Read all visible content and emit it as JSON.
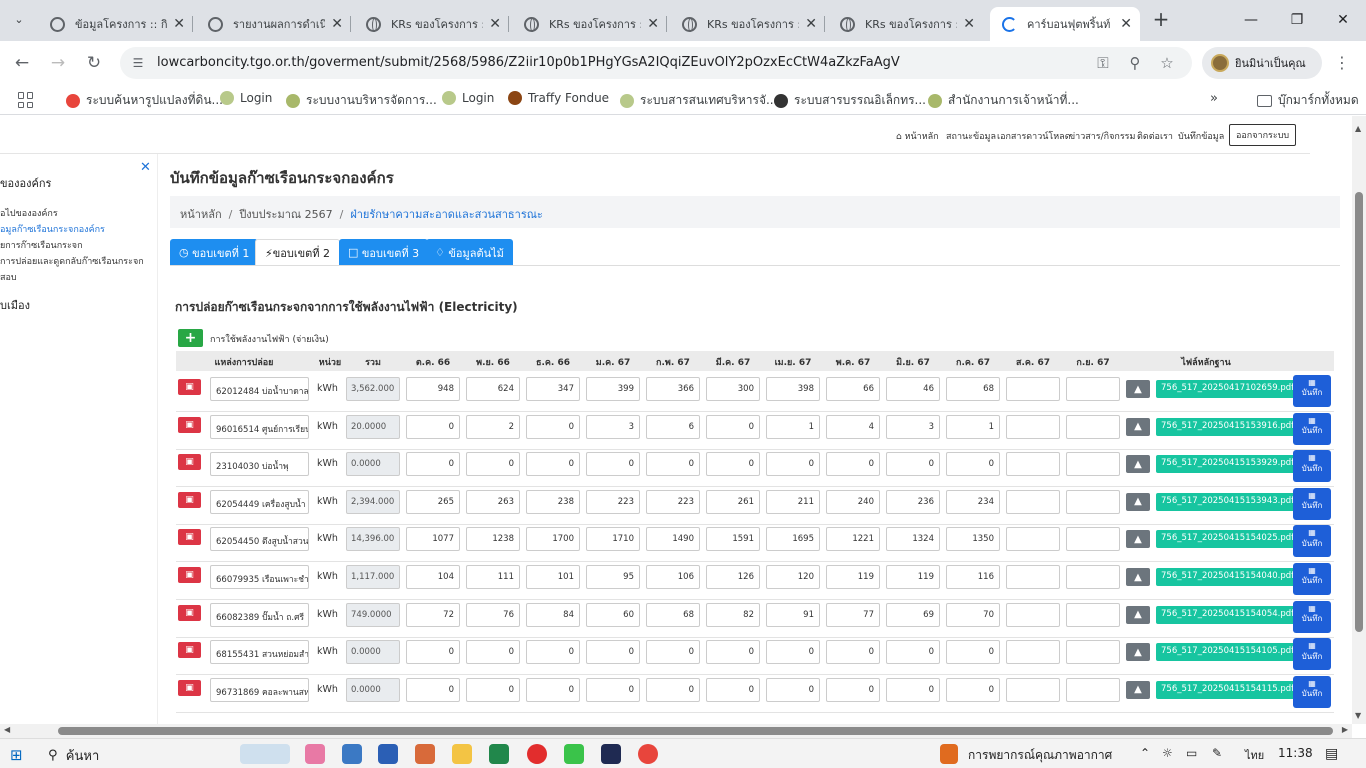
{
  "browser": {
    "tabs": [
      {
        "title": "ข้อมูลโครงการ :: กิจ",
        "active": false
      },
      {
        "title": "รายงานผลการดำเนิ",
        "active": false
      },
      {
        "title": "KRs ของโครงการ ::",
        "active": false
      },
      {
        "title": "KRs ของโครงการ ::",
        "active": false
      },
      {
        "title": "KRs ของโครงการ ::",
        "active": false
      },
      {
        "title": "KRs ของโครงการ ::",
        "active": false
      },
      {
        "title": "คาร์บอนฟุตพริ้นท์",
        "active": true
      }
    ],
    "url": "lowcarboncity.tgo.or.th/goverment/submit/2568/5986/Z2iir10p0b1PHgYGsA2IQqiZEuvOlY2pOzxEcCtW4aZkzFaAgV",
    "profile_label": "ยินมิน่าเป็นคุณ",
    "bookmarks": [
      "ระบบค้นหารูปแปลงที่ดิน...",
      "Login",
      "ระบบงานบริหารจัดการ...",
      "Login",
      "Traffy Fondue",
      "ระบบสารสนเทศบริหารจั...",
      "ระบบสารบรรณอิเล็กทร...",
      "สำนักงานการเจ้าหน้าที่..."
    ],
    "bookmarks_all": "บุ๊กมาร์กทั้งหมด"
  },
  "topnav": {
    "items": [
      "หน้าหลัก",
      "สถานะข้อมูล",
      "เอกสารดาวน์โหลด",
      "ข่าวสาร/กิจกรรม",
      "ติดต่อเรา",
      "บันทึกข้อมูล"
    ],
    "logout": "ออกจากระบบ"
  },
  "sidebar": {
    "heading": "ขององค์กร",
    "items": [
      "อไปขององค์กร",
      "อมูลก๊าซเรือนกระจกองค์กร",
      "ยการก๊าซเรือนกระจก",
      "การปล่อยและดูดกลับก๊าซเรือนกระจก",
      "สอบ"
    ],
    "heading2": "บเมือง"
  },
  "main": {
    "title": "บันทึกข้อมูลก๊าซเรือนกระจกองค์กร",
    "breadcrumb": [
      "หน้าหลัก",
      "ปีงบประมาณ 2567",
      "ฝ่ายรักษาความสะอาดและสวนสาธารณะ"
    ],
    "tabs": [
      "ขอบเขตที่ 1",
      "ขอบเขตที่ 2",
      "ขอบเขตที่ 3",
      "ข้อมูลต้นไม้"
    ],
    "section_title": "การปล่อยก๊าซเรือนกระจกจากการใช้พลังงานไฟฟ้า (Electricity)",
    "add_label": "การใช้พลังงานไฟฟ้า (จ่ายเงิน)",
    "headers": [
      "แหล่งการปล่อย",
      "หน่วย",
      "รวม",
      "ต.ค. 66",
      "พ.ย. 66",
      "ธ.ค. 66",
      "ม.ค. 67",
      "ก.พ. 67",
      "มี.ค. 67",
      "เม.ย. 67",
      "พ.ค. 67",
      "มิ.ย. 67",
      "ก.ค. 67",
      "ส.ค. 67",
      "ก.ย. 67",
      "ไฟล์หลักฐาน"
    ],
    "save_label": "บันทึก",
    "rows": [
      {
        "source": "62012484 บ่อน้ำบาดาล",
        "unit": "kWh",
        "total": "3,562.000",
        "months": [
          "948",
          "624",
          "347",
          "399",
          "366",
          "300",
          "398",
          "66",
          "46",
          "68",
          "",
          ""
        ],
        "file": "756_517_20250417102659.pdf"
      },
      {
        "source": "96016514 ศูนย์การเรียน",
        "unit": "kWh",
        "total": "20.0000",
        "months": [
          "0",
          "2",
          "0",
          "3",
          "6",
          "0",
          "1",
          "4",
          "3",
          "1",
          "",
          ""
        ],
        "file": "756_517_20250415153916.pdf"
      },
      {
        "source": "23104030 บ่อน้ำพุ",
        "unit": "kWh",
        "total": "0.0000",
        "months": [
          "0",
          "0",
          "0",
          "0",
          "0",
          "0",
          "0",
          "0",
          "0",
          "0",
          "",
          ""
        ],
        "file": "756_517_20250415153929.pdf"
      },
      {
        "source": "62054449 เครื่องสูบน้ำ",
        "unit": "kWh",
        "total": "2,394.000",
        "months": [
          "265",
          "263",
          "238",
          "223",
          "223",
          "261",
          "211",
          "240",
          "236",
          "234",
          "",
          ""
        ],
        "file": "756_517_20250415153943.pdf"
      },
      {
        "source": "62054450 ตึงสูบน้ำสวน",
        "unit": "kWh",
        "total": "14,396.00",
        "months": [
          "1077",
          "1238",
          "1700",
          "1710",
          "1490",
          "1591",
          "1695",
          "1221",
          "1324",
          "1350",
          "",
          ""
        ],
        "file": "756_517_20250415154025.pdf"
      },
      {
        "source": "66079935 เรือนเพาะชำ",
        "unit": "kWh",
        "total": "1,117.000",
        "months": [
          "104",
          "111",
          "101",
          "95",
          "106",
          "126",
          "120",
          "119",
          "119",
          "116",
          "",
          ""
        ],
        "file": "756_517_20250415154040.pdf"
      },
      {
        "source": "66082389 ปั๊มน้ำ ถ.ศรี",
        "unit": "kWh",
        "total": "749.0000",
        "months": [
          "72",
          "76",
          "84",
          "60",
          "68",
          "82",
          "91",
          "77",
          "69",
          "70",
          "",
          ""
        ],
        "file": "756_517_20250415154054.pdf"
      },
      {
        "source": "68155431 สวนหย่อมสำ",
        "unit": "kWh",
        "total": "0.0000",
        "months": [
          "0",
          "0",
          "0",
          "0",
          "0",
          "0",
          "0",
          "0",
          "0",
          "0",
          "",
          ""
        ],
        "file": "756_517_20250415154105.pdf"
      },
      {
        "source": "96731869 คอละพานสห",
        "unit": "kWh",
        "total": "0.0000",
        "months": [
          "0",
          "0",
          "0",
          "0",
          "0",
          "0",
          "0",
          "0",
          "0",
          "0",
          "",
          ""
        ],
        "file": "756_517_20250415154115.pdf"
      }
    ]
  },
  "taskbar": {
    "search": "ค้นหา",
    "weather": "การพยากรณ์คุณภาพอากาศ",
    "lang": "ไทย",
    "time": "11:38"
  }
}
